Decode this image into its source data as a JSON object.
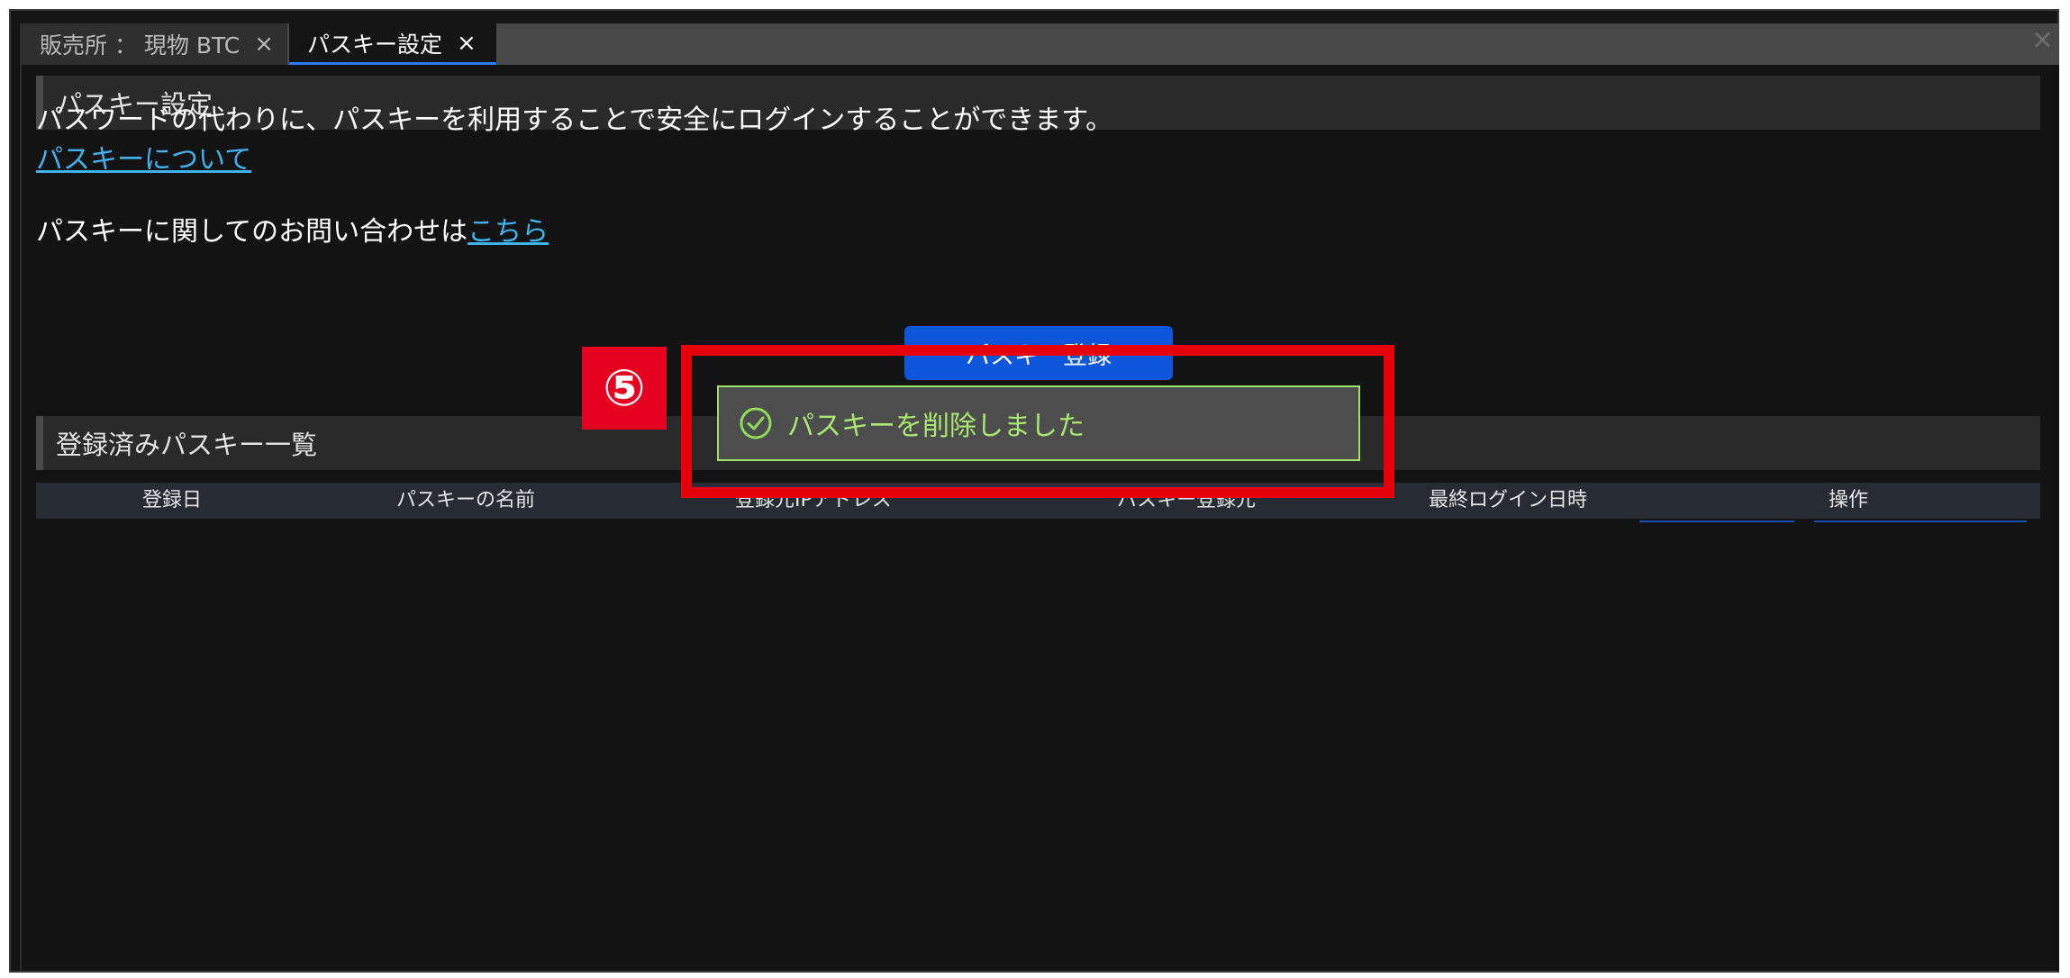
{
  "tabs": [
    {
      "label": "販売所 ： 現物 BTC",
      "close": "×"
    },
    {
      "label": "パスキー設定",
      "close": "×"
    }
  ],
  "window_close": "✕",
  "passkey_section": {
    "title": "パスキー設定",
    "description": "パスワードの代わりに、パスキーを利用することで安全にログインすることができます。",
    "about_link": "パスキーについて",
    "inquiry_prefix": "パスキーに関してのお問い合わせは",
    "inquiry_link": "こちら",
    "register_button": "パスキー登録"
  },
  "registered_section": {
    "title": "登録済みパスキー一覧",
    "columns": [
      "登録日",
      "パスキーの名前",
      "登録元IPアドレス",
      "パスキー登録元",
      "最終ログイン日時",
      "操作"
    ]
  },
  "annotation": {
    "step": "⑤"
  },
  "toast": {
    "message": "パスキーを削除しました",
    "icon": "check-circle-icon",
    "color": "#a8e872"
  }
}
